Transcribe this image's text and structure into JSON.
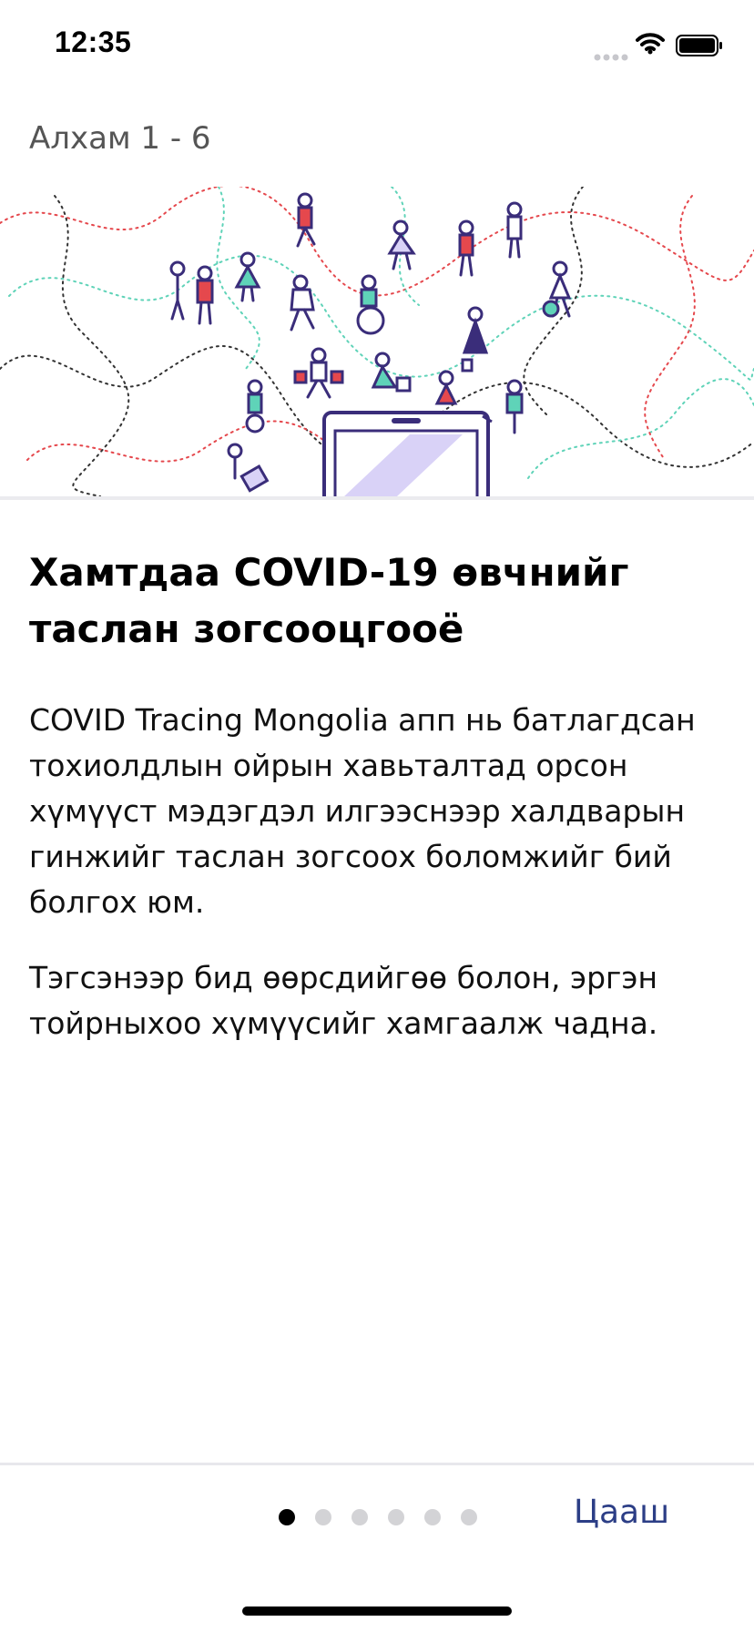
{
  "status_bar": {
    "time": "12:35"
  },
  "step": {
    "label": "Алхам 1  -  6"
  },
  "content": {
    "headline": "Хамтдаа COVID-19 өвчнийг таслан зогсооцгооё",
    "paragraph_1": "COVID Tracing Mongolia апп нь батлагдсан тохиолдлын ойрын хавьталтад орсон хүмүүст мэдэгдэл илгээснээр халдварын гинжийг таслан зогсоох боломжийг бий болгох юм.",
    "paragraph_2": "Тэгсэнээр бид өөрсдийгөө болон, эргэн тойрныхоо хүмүүсийг хамгаалж чадна."
  },
  "pagination": {
    "total": 6,
    "current": 1
  },
  "footer": {
    "next_label": "Цааш"
  },
  "colors": {
    "accent": "#2c3e86",
    "dot_active": "#000000",
    "dot_inactive": "#d3d3d6",
    "illustration_red": "#e5484d",
    "illustration_teal": "#5fd3b8",
    "illustration_purple": "#3a2d7a",
    "illustration_lavender": "#d9d2f7"
  }
}
